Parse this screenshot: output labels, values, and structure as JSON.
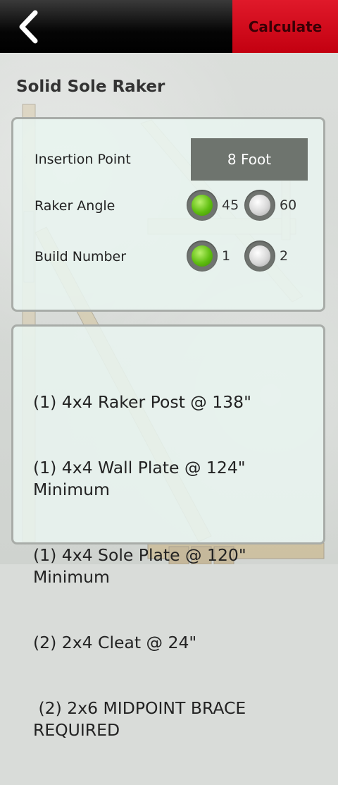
{
  "header": {
    "back_icon": "chevron-left-icon",
    "calculate_label": "Calculate",
    "accent_color": "#d8101f"
  },
  "page": {
    "title": "Solid Sole Raker"
  },
  "form": {
    "insertion_point": {
      "label": "Insertion Point",
      "value": "8 Foot"
    },
    "raker_angle": {
      "label": "Raker Angle",
      "options": [
        {
          "label": "45",
          "selected": true
        },
        {
          "label": "60",
          "selected": false
        }
      ]
    },
    "build_number": {
      "label": "Build Number",
      "options": [
        {
          "label": "1",
          "selected": true
        },
        {
          "label": "2",
          "selected": false
        }
      ]
    }
  },
  "results": {
    "lines": [
      "(1) 4x4 Raker Post @ 138\"",
      "(1) 4x4 Wall Plate @ 124\" Minimum",
      "(1) 4x4 Sole Plate @ 120\" Minimum",
      "(2) 2x4 Cleat @ 24\"",
      " (2) 2x6 MIDPOINT BRACE REQUIRED"
    ]
  }
}
